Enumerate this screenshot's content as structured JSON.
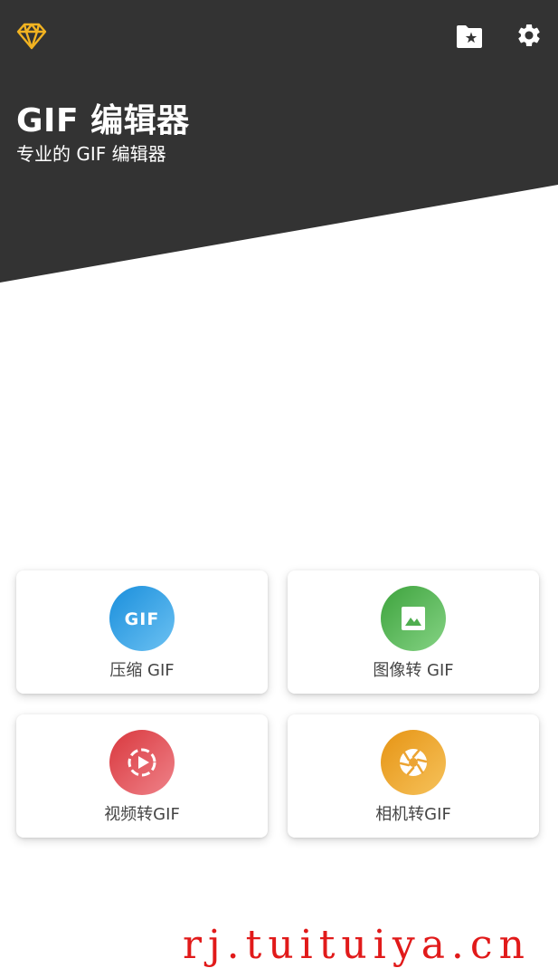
{
  "colors": {
    "header_bg": "#333333",
    "accent_gold": "#f2b321",
    "compress_gradient": [
      "#1a8fdc",
      "#6cc1f2"
    ],
    "image_gradient": [
      "#3da33d",
      "#85d384"
    ],
    "video_gradient": [
      "#d9383e",
      "#ef8289"
    ],
    "camera_gradient": [
      "#e69414",
      "#f6c25b"
    ],
    "watermark": "#e11a1a"
  },
  "header": {
    "title": "GIF 编辑器",
    "subtitle": "专业的 GIF 编辑器",
    "icons": {
      "left": "diamond-icon",
      "right": [
        "folder-star-icon",
        "gear-icon"
      ]
    }
  },
  "tools": [
    {
      "label": "压缩 GIF",
      "icon": "gif-icon",
      "icon_text": "GIF"
    },
    {
      "label": "图像转 GIF",
      "icon": "image-icon"
    },
    {
      "label": "视频转GIF",
      "icon": "video-play-icon"
    },
    {
      "label": "相机转GIF",
      "icon": "camera-aperture-icon"
    }
  ],
  "watermark": "rj.tuituiya.cn"
}
